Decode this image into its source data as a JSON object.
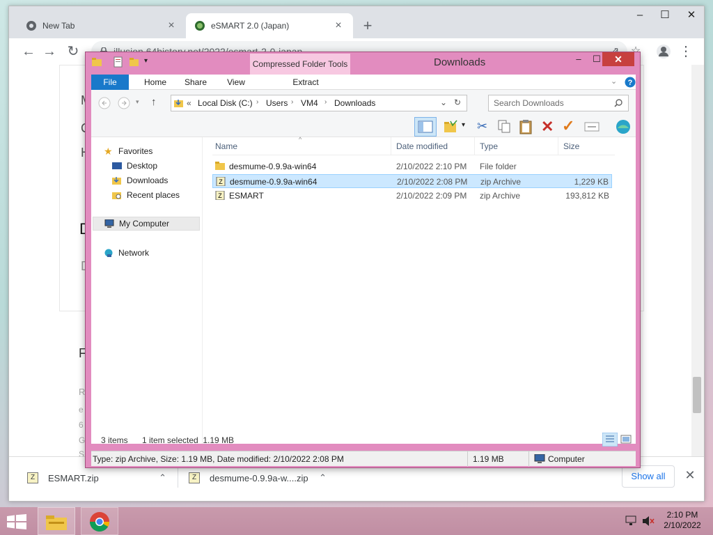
{
  "chrome": {
    "tabs": [
      {
        "label": "New Tab",
        "icon": "chrome-icon"
      },
      {
        "label": "eSMART 2.0 (Japan)",
        "icon": "site-favicon"
      }
    ],
    "address": "illusion.64history.net/2022/esmart-2-0-japan",
    "downloads": [
      {
        "name": "ESMART.zip"
      },
      {
        "name": "desmume-0.9.9a-w....zip"
      }
    ],
    "show_all": "Show all"
  },
  "explorer": {
    "title": "Downloads",
    "context_tab": "Compressed Folder Tools",
    "ribbon_tabs": [
      "File",
      "Home",
      "Share",
      "View"
    ],
    "context_subtab": "Extract",
    "breadcrumb": [
      "Local Disk (C:)",
      "Users",
      "VM4",
      "Downloads"
    ],
    "breadcrumb_prefix": "«",
    "search_placeholder": "Search Downloads",
    "nav": {
      "favorites": "Favorites",
      "desktop": "Desktop",
      "downloads": "Downloads",
      "recent": "Recent places",
      "computer": "My Computer",
      "network": "Network"
    },
    "columns": [
      "Name",
      "Date modified",
      "Type",
      "Size"
    ],
    "files": [
      {
        "name": "desmume-0.9.9a-win64",
        "date": "2/10/2022 2:10 PM",
        "type": "File folder",
        "size": "",
        "kind": "folder",
        "selected": false
      },
      {
        "name": "desmume-0.9.9a-win64",
        "date": "2/10/2022 2:08 PM",
        "type": "zip Archive",
        "size": "1,229 KB",
        "kind": "zip",
        "selected": true
      },
      {
        "name": "ESMART",
        "date": "2/10/2022 2:09 PM",
        "type": "zip Archive",
        "size": "193,812 KB",
        "kind": "zip",
        "selected": false
      }
    ],
    "status": {
      "items": "3 items",
      "selected": "1 item selected  1.19 MB",
      "details": "Type: zip Archive, Size: 1.19 MB, Date modified: 2/10/2022 2:08 PM",
      "size": "1.19 MB",
      "location": "Computer"
    }
  },
  "page_behind": {
    "letters": [
      "M",
      "C",
      "H",
      "D",
      "D",
      "F",
      "R",
      "e",
      "6",
      "G",
      "S"
    ]
  },
  "taskbar": {
    "time": "2:10 PM",
    "date": "2/10/2022"
  },
  "colors": {
    "explorer_frame": "#e28cbf",
    "ribbon_file": "#1979ca",
    "selection": "#cce8ff",
    "taskbar": "#c99aac",
    "close_button": "#c7403f"
  }
}
